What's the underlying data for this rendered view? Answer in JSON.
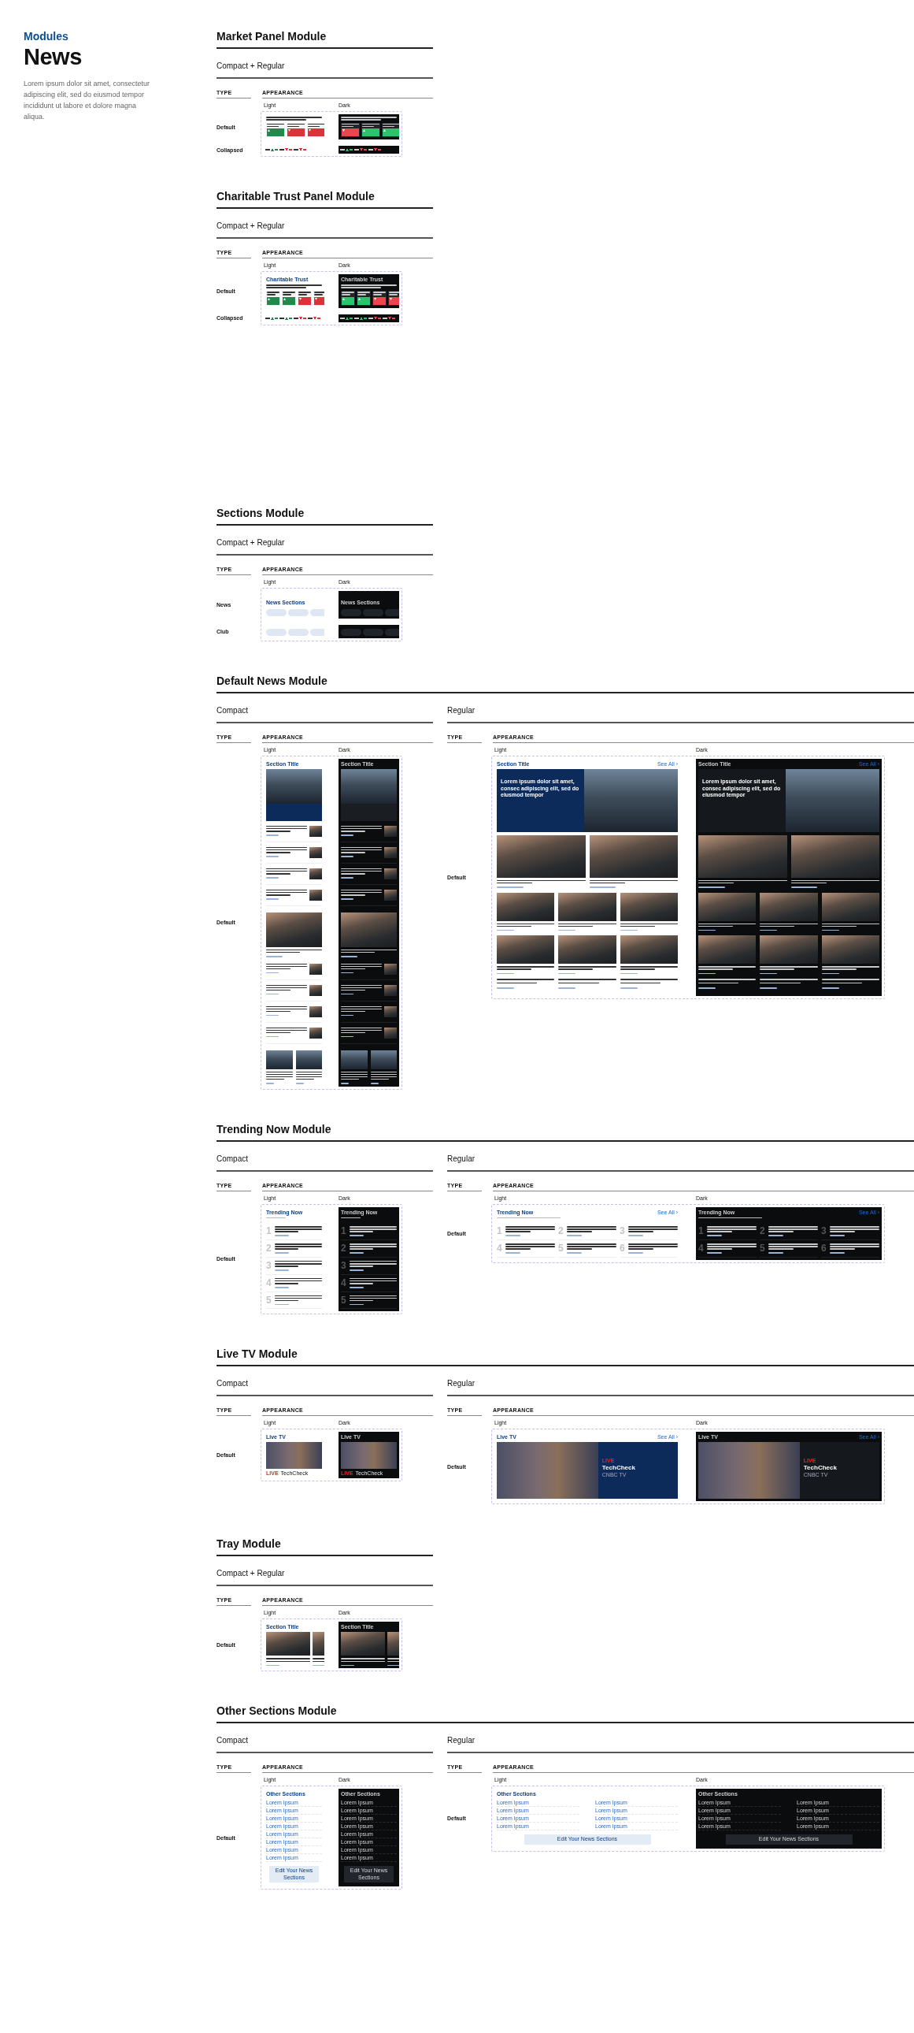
{
  "header": {
    "eyebrow": "Modules",
    "title": "News",
    "description": "Lorem ipsum dolor sit amet, consectetur adipiscing elit, sed do eiusmod tempor incididunt ut labore et dolore magna aliqua."
  },
  "modules": [
    {
      "title": "Market Panel Module",
      "variants": [
        {
          "label": "Compact + Regular",
          "kind": "half",
          "type_heading": "TYPE",
          "appearance_heading": "APPEARANCE",
          "columns": [
            "Light",
            "Dark"
          ],
          "rows": [
            {
              "type": "Default",
              "panels": [
                {
                  "dark": false,
                  "kind": "market",
                  "tickers": [
                    {
                      "up": true,
                      "color": "#1f8a4c"
                    },
                    {
                      "up": false,
                      "color": "#d8343a"
                    },
                    {
                      "up": false,
                      "color": "#d8343a"
                    }
                  ]
                },
                {
                  "dark": true,
                  "kind": "market",
                  "tickers": [
                    {
                      "up": false,
                      "color": "#e8484d"
                    },
                    {
                      "up": true,
                      "color": "#2bc36b"
                    },
                    {
                      "up": true,
                      "color": "#2bc36b"
                    }
                  ]
                }
              ]
            },
            {
              "type": "Collapsed",
              "panels": [
                {
                  "dark": false,
                  "kind": "ticker-strip",
                  "tickers": [
                    {
                      "up": true,
                      "color": "#1f8a4c"
                    },
                    {
                      "up": false,
                      "color": "#d8343a"
                    },
                    {
                      "up": false,
                      "color": "#d8343a"
                    }
                  ]
                },
                {
                  "dark": true,
                  "kind": "ticker-strip",
                  "tickers": [
                    {
                      "up": true,
                      "color": "#2bc36b"
                    },
                    {
                      "up": false,
                      "color": "#e8484d"
                    },
                    {
                      "up": false,
                      "color": "#e8484d"
                    }
                  ]
                }
              ]
            }
          ]
        }
      ]
    },
    {
      "title": "Charitable Trust Panel Module",
      "variants": [
        {
          "label": "Compact + Regular",
          "kind": "half",
          "type_heading": "TYPE",
          "appearance_heading": "APPEARANCE",
          "columns": [
            "Light",
            "Dark"
          ],
          "rows": [
            {
              "type": "Default",
              "panels": [
                {
                  "dark": false,
                  "kind": "trust",
                  "title": "Charitable Trust",
                  "tickers": [
                    {
                      "up": true,
                      "color": "#1f8a4c"
                    },
                    {
                      "up": true,
                      "color": "#1f8a4c"
                    },
                    {
                      "up": false,
                      "color": "#d8343a"
                    },
                    {
                      "up": false,
                      "color": "#d8343a"
                    }
                  ]
                },
                {
                  "dark": true,
                  "kind": "trust",
                  "title": "Charitable Trust",
                  "tickers": [
                    {
                      "up": true,
                      "color": "#2bc36b"
                    },
                    {
                      "up": true,
                      "color": "#2bc36b"
                    },
                    {
                      "up": false,
                      "color": "#e8484d"
                    },
                    {
                      "up": false,
                      "color": "#e8484d"
                    }
                  ]
                }
              ]
            },
            {
              "type": "Collapsed",
              "panels": [
                {
                  "dark": false,
                  "kind": "ticker-strip",
                  "tickers": [
                    {
                      "up": true,
                      "color": "#1f8a4c"
                    },
                    {
                      "up": true,
                      "color": "#1f8a4c"
                    },
                    {
                      "up": false,
                      "color": "#d8343a"
                    },
                    {
                      "up": false,
                      "color": "#d8343a"
                    }
                  ]
                },
                {
                  "dark": true,
                  "kind": "ticker-strip",
                  "tickers": [
                    {
                      "up": true,
                      "color": "#2bc36b"
                    },
                    {
                      "up": true,
                      "color": "#2bc36b"
                    },
                    {
                      "up": false,
                      "color": "#e8484d"
                    },
                    {
                      "up": false,
                      "color": "#e8484d"
                    }
                  ]
                }
              ]
            }
          ]
        }
      ]
    },
    {
      "title": "Sections Module",
      "variants": [
        {
          "label": "Compact + Regular",
          "kind": "half",
          "type_heading": "TYPE",
          "appearance_heading": "APPEARANCE",
          "columns": [
            "Light",
            "Dark"
          ],
          "rows": [
            {
              "type": "News",
              "panels": [
                {
                  "dark": false,
                  "kind": "sections",
                  "title": "News Sections"
                },
                {
                  "dark": true,
                  "kind": "sections",
                  "title": "News Sections"
                }
              ]
            },
            {
              "type": "Club",
              "panels": [
                {
                  "dark": false,
                  "kind": "sections"
                },
                {
                  "dark": true,
                  "kind": "sections"
                }
              ]
            }
          ]
        }
      ]
    },
    {
      "title": "Default News Module",
      "variants": [
        {
          "label": "Compact",
          "kind": "half",
          "type_heading": "TYPE",
          "appearance_heading": "APPEARANCE",
          "columns": [
            "Light",
            "Dark"
          ],
          "rows": [
            {
              "type": "Default",
              "panels": [
                {
                  "dark": false,
                  "kind": "news-compact",
                  "title": "Section Title"
                },
                {
                  "dark": true,
                  "kind": "news-compact",
                  "title": "Section Title"
                }
              ]
            }
          ]
        },
        {
          "label": "Regular",
          "kind": "wide",
          "type_heading": "TYPE",
          "appearance_heading": "APPEARANCE",
          "columns": [
            "Light",
            "Dark"
          ],
          "rows": [
            {
              "type": "Default",
              "panels": [
                {
                  "dark": false,
                  "kind": "news-regular",
                  "title": "Section Title",
                  "link": "See All ›",
                  "headline": "Lorem ipsum dolor sit amet, consec adipiscing elit, sed do eiusmod tempor"
                },
                {
                  "dark": true,
                  "kind": "news-regular",
                  "title": "Section Title",
                  "link": "See All ›",
                  "headline": "Lorem ipsum dolor sit amet, consec adipiscing elit, sed do eiusmod tempor"
                }
              ]
            }
          ]
        }
      ]
    },
    {
      "title": "Trending Now Module",
      "variants": [
        {
          "label": "Compact",
          "kind": "half",
          "type_heading": "TYPE",
          "appearance_heading": "APPEARANCE",
          "columns": [
            "Light",
            "Dark"
          ],
          "rows": [
            {
              "type": "Default",
              "panels": [
                {
                  "dark": false,
                  "kind": "trending-compact",
                  "title": "Trending Now",
                  "ranks": [
                    "1",
                    "2",
                    "3",
                    "4",
                    "5"
                  ]
                },
                {
                  "dark": true,
                  "kind": "trending-compact",
                  "title": "Trending Now",
                  "ranks": [
                    "1",
                    "2",
                    "3",
                    "4",
                    "5"
                  ]
                }
              ]
            }
          ]
        },
        {
          "label": "Regular",
          "kind": "wide",
          "type_heading": "TYPE",
          "appearance_heading": "APPEARANCE",
          "columns": [
            "Light",
            "Dark"
          ],
          "rows": [
            {
              "type": "Default",
              "panels": [
                {
                  "dark": false,
                  "kind": "trending-regular",
                  "title": "Trending Now",
                  "link": "See All ›",
                  "ranks": [
                    "1",
                    "2",
                    "3",
                    "4",
                    "5",
                    "6"
                  ]
                },
                {
                  "dark": true,
                  "kind": "trending-regular",
                  "title": "Trending Now",
                  "link": "See All ›",
                  "ranks": [
                    "1",
                    "2",
                    "3",
                    "4",
                    "5",
                    "6"
                  ]
                }
              ]
            }
          ]
        }
      ]
    },
    {
      "title": "Live TV Module",
      "variants": [
        {
          "label": "Compact",
          "kind": "half",
          "type_heading": "TYPE",
          "appearance_heading": "APPEARANCE",
          "columns": [
            "Light",
            "Dark"
          ],
          "rows": [
            {
              "type": "Default",
              "panels": [
                {
                  "dark": false,
                  "kind": "livetv-compact",
                  "title": "Live TV",
                  "live": "LIVE",
                  "show": "TechCheck"
                },
                {
                  "dark": true,
                  "kind": "livetv-compact",
                  "title": "Live TV",
                  "live": "LIVE",
                  "show": "TechCheck"
                }
              ]
            }
          ]
        },
        {
          "label": "Regular",
          "kind": "wide",
          "type_heading": "TYPE",
          "appearance_heading": "APPEARANCE",
          "columns": [
            "Light",
            "Dark"
          ],
          "rows": [
            {
              "type": "Default",
              "panels": [
                {
                  "dark": false,
                  "kind": "livetv-regular",
                  "title": "Live TV",
                  "link": "See All ›",
                  "live": "LIVE",
                  "show": "TechCheck",
                  "network": "CNBC TV"
                },
                {
                  "dark": true,
                  "kind": "livetv-regular",
                  "title": "Live TV",
                  "link": "See All ›",
                  "live": "LIVE",
                  "show": "TechCheck",
                  "network": "CNBC TV"
                }
              ]
            }
          ]
        }
      ]
    },
    {
      "title": "Tray Module",
      "variants": [
        {
          "label": "Compact + Regular",
          "kind": "half",
          "type_heading": "TYPE",
          "appearance_heading": "APPEARANCE",
          "columns": [
            "Light",
            "Dark"
          ],
          "rows": [
            {
              "type": "Default",
              "panels": [
                {
                  "dark": false,
                  "kind": "tray",
                  "title": "Section Title"
                },
                {
                  "dark": true,
                  "kind": "tray",
                  "title": "Section Title"
                }
              ]
            }
          ]
        }
      ]
    },
    {
      "title": "Other Sections Module",
      "variants": [
        {
          "label": "Compact",
          "kind": "half",
          "type_heading": "TYPE",
          "appearance_heading": "APPEARANCE",
          "columns": [
            "Light",
            "Dark"
          ],
          "rows": [
            {
              "type": "Default",
              "panels": [
                {
                  "dark": false,
                  "kind": "other-compact",
                  "title": "Other Sections",
                  "items": [
                    "Lorem Ipsum",
                    "Lorem Ipsum",
                    "Lorem Ipsum",
                    "Lorem Ipsum",
                    "Lorem Ipsum",
                    "Lorem Ipsum",
                    "Lorem Ipsum",
                    "Lorem Ipsum"
                  ],
                  "button": "Edit Your News Sections"
                },
                {
                  "dark": true,
                  "kind": "other-compact",
                  "title": "Other Sections",
                  "items": [
                    "Lorem Ipsum",
                    "Lorem Ipsum",
                    "Lorem Ipsum",
                    "Lorem Ipsum",
                    "Lorem Ipsum",
                    "Lorem Ipsum",
                    "Lorem Ipsum",
                    "Lorem Ipsum"
                  ],
                  "button": "Edit Your News Sections"
                }
              ]
            }
          ]
        },
        {
          "label": "Regular",
          "kind": "wide",
          "type_heading": "TYPE",
          "appearance_heading": "APPEARANCE",
          "columns": [
            "Light",
            "Dark"
          ],
          "rows": [
            {
              "type": "Default",
              "panels": [
                {
                  "dark": false,
                  "kind": "other-regular",
                  "title": "Other Sections",
                  "items": [
                    "Lorem Ipsum",
                    "Lorem Ipsum",
                    "Lorem Ipsum",
                    "Lorem Ipsum",
                    "Lorem Ipsum",
                    "Lorem Ipsum",
                    "Lorem Ipsum",
                    "Lorem Ipsum"
                  ],
                  "button": "Edit Your News Sections"
                },
                {
                  "dark": true,
                  "kind": "other-regular",
                  "title": "Other Sections",
                  "items": [
                    "Lorem Ipsum",
                    "Lorem Ipsum",
                    "Lorem Ipsum",
                    "Lorem Ipsum",
                    "Lorem Ipsum",
                    "Lorem Ipsum",
                    "Lorem Ipsum",
                    "Lorem Ipsum"
                  ],
                  "button": "Edit Your News Sections"
                }
              ]
            }
          ]
        }
      ]
    }
  ]
}
